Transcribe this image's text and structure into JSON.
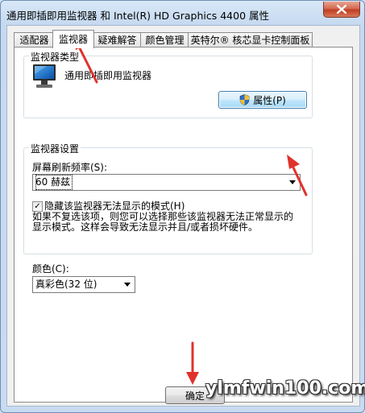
{
  "window": {
    "title": "通用即插即用监视器 和 Intel(R) HD Graphics 4400 属性"
  },
  "tabs": [
    {
      "label": "适配器",
      "active": false
    },
    {
      "label": "监视器",
      "active": true
    },
    {
      "label": "疑难解答",
      "active": false
    },
    {
      "label": "颜色管理",
      "active": false
    },
    {
      "label": "英特尔® 核芯显卡控制面板",
      "active": false
    }
  ],
  "monitor_type": {
    "group_title": "监视器类型",
    "device_name": "通用即插即用监视器",
    "properties_button": "属性(P)"
  },
  "monitor_settings": {
    "group_title": "监视器设置",
    "refresh_label": "屏幕刷新频率(S):",
    "refresh_value": "60 赫兹",
    "hide_modes_checkbox": {
      "label": "隐藏该监视器无法显示的模式(H)",
      "checked": true
    },
    "help_text_line1": "如果不复选该项，则您可以选择那些该监视器无法正常显示的",
    "help_text_line2": "显示模式。这样会导致无法显示并且/或者损坏硬件。"
  },
  "color": {
    "label": "颜色(C):",
    "value": "真彩色(32 位)"
  },
  "footer": {
    "ok_button": "确定"
  },
  "watermark": "ylmfwin100.com",
  "colors": {
    "annotation_arrow": "#e0322b",
    "close_button": "#c13e22"
  }
}
